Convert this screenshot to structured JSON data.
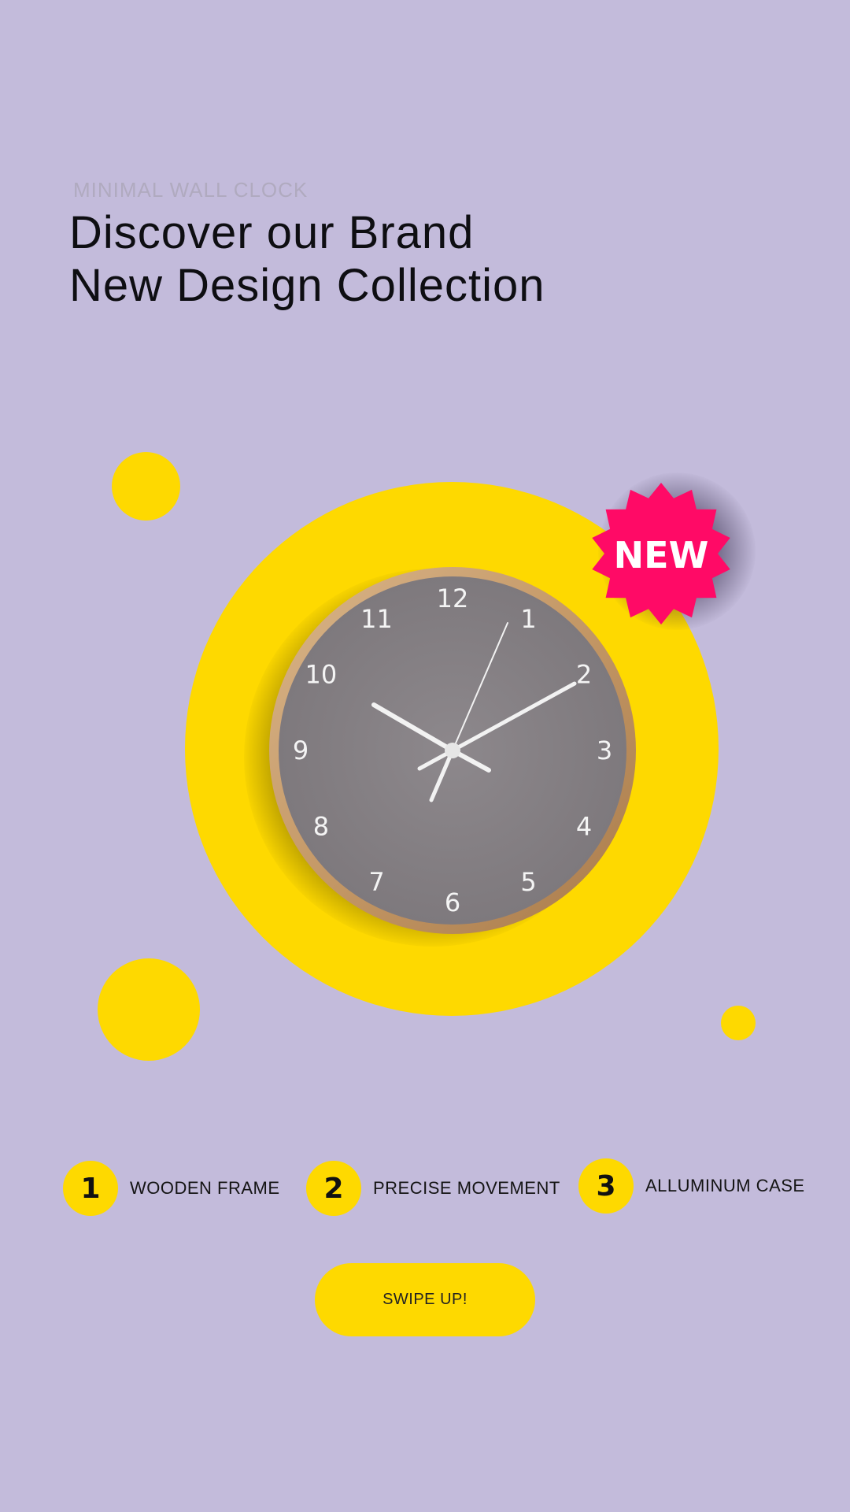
{
  "header": {
    "eyebrow": "MINIMAL WALL CLOCK",
    "headline_line1": "Discover our Brand",
    "headline_line2": "New Design Collection"
  },
  "product": {
    "badge_label": "NEW",
    "clock_numerals": [
      "12",
      "1",
      "2",
      "3",
      "4",
      "5",
      "6",
      "7",
      "8",
      "9",
      "10",
      "11"
    ],
    "colors": {
      "background": "#c3bbdb",
      "accent_yellow": "#fed900",
      "badge_pink": "#ff0a66",
      "clock_face": "#8a8589",
      "clock_frame": "#c49866"
    }
  },
  "features": [
    {
      "number": "1",
      "label": "WOODEN FRAME"
    },
    {
      "number": "2",
      "label": "PRECISE MOVEMENT"
    },
    {
      "number": "3",
      "label": "ALLUMINUM CASE"
    }
  ],
  "cta": {
    "label": "SWIPE UP!"
  }
}
